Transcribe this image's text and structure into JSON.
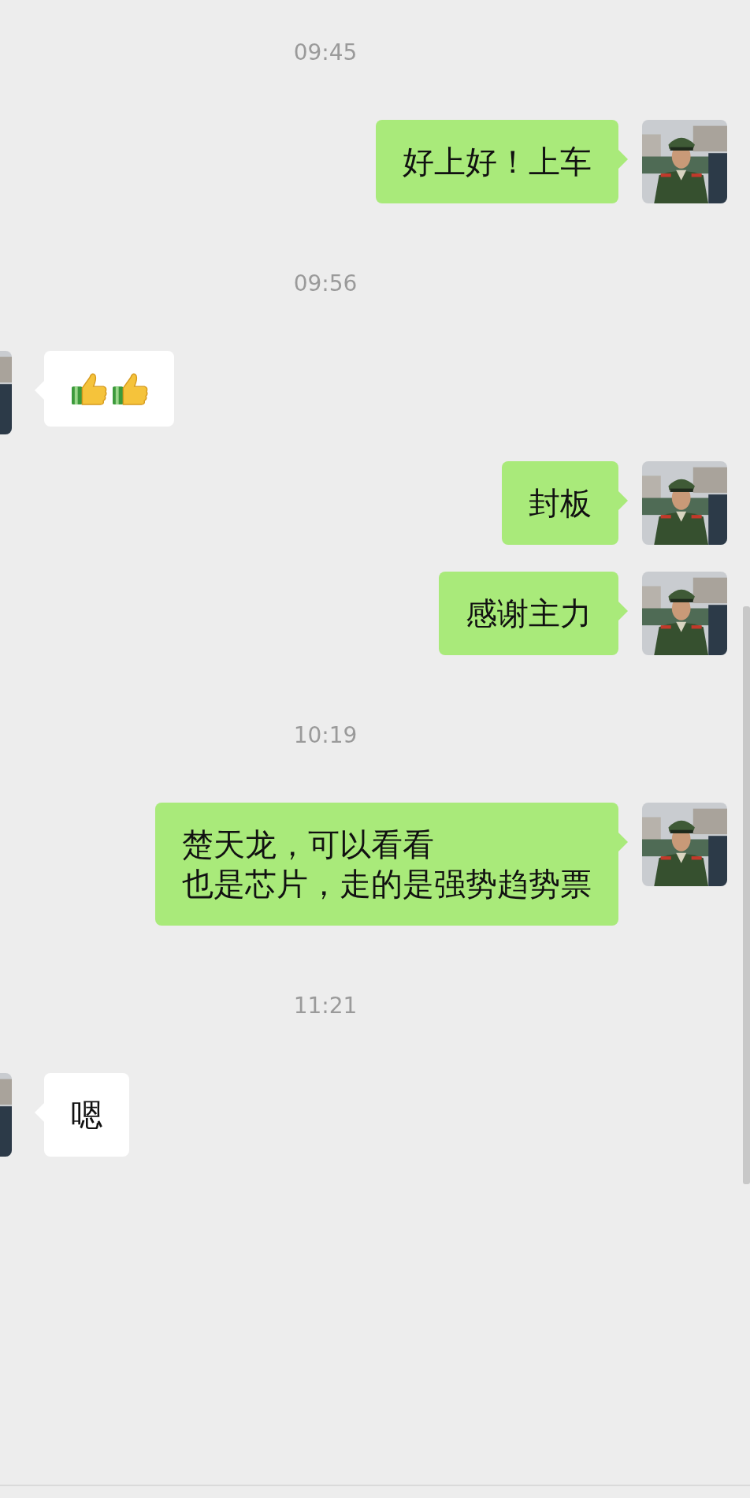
{
  "messages": [
    {
      "kind": "time",
      "text": "09:45"
    },
    {
      "kind": "sent",
      "lines": [
        "好上好！上车"
      ]
    },
    {
      "kind": "time",
      "text": "09:56"
    },
    {
      "kind": "received_thumbs"
    },
    {
      "kind": "sent",
      "lines": [
        "封板"
      ]
    },
    {
      "kind": "sent",
      "lines": [
        "感谢主力"
      ]
    },
    {
      "kind": "time",
      "text": "10:19"
    },
    {
      "kind": "sent",
      "lines": [
        "楚天龙，可以看看",
        "也是芯片，走的是强势趋势票"
      ]
    },
    {
      "kind": "time",
      "text": "11:21"
    },
    {
      "kind": "received",
      "lines": [
        "嗯"
      ]
    }
  ]
}
